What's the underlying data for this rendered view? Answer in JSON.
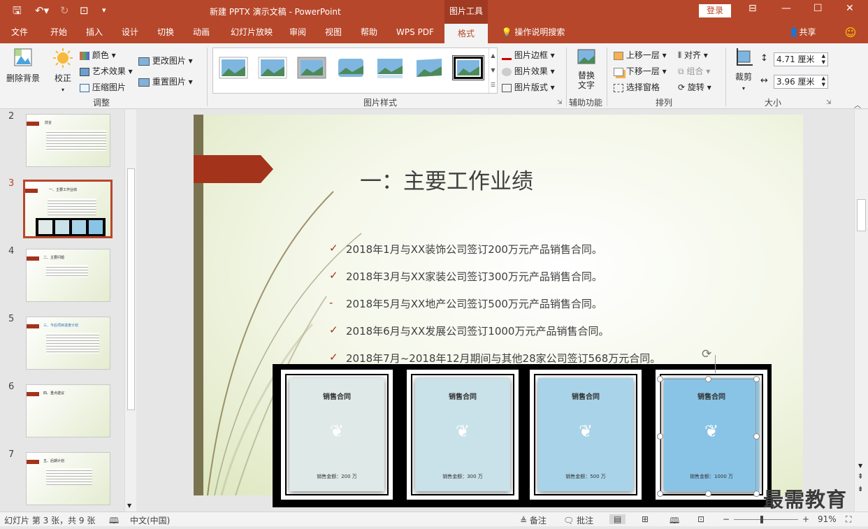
{
  "titlebar": {
    "title": "新建 PPTX 演示文稿  -  PowerPoint",
    "context_tab": "图片工具",
    "login": "登录"
  },
  "tabs": [
    "文件",
    "开始",
    "插入",
    "设计",
    "切换",
    "动画",
    "幻灯片放映",
    "审阅",
    "视图",
    "帮助",
    "WPS PDF",
    "格式"
  ],
  "active_tab": "格式",
  "tell_me": "操作说明搜索",
  "share": "共享",
  "ribbon": {
    "remove_bg": "删除背景",
    "correct": "校正",
    "color": "颜色",
    "art_effects": "艺术效果",
    "compress": "压缩图片",
    "change_pic": "更改图片",
    "reset_pic": "重置图片",
    "group_adjust": "调整",
    "group_styles": "图片样式",
    "border": "图片边框",
    "effects": "图片效果",
    "layout": "图片版式",
    "alt_text": "替换\n文字",
    "group_access": "辅助功能",
    "bring_forward": "上移一层",
    "send_backward": "下移一层",
    "selection_pane": "选择窗格",
    "align": "对齐",
    "group": "组合",
    "rotate": "旋转",
    "group_arrange": "排列",
    "crop": "裁剪",
    "height": "4.71 厘米",
    "width": "3.96 厘米",
    "group_size": "大小"
  },
  "thumbnails": [
    {
      "num": "2",
      "title": "前言"
    },
    {
      "num": "3",
      "title": "一、主要工作业绩"
    },
    {
      "num": "4",
      "title": "二、主要问题"
    },
    {
      "num": "5",
      "title": "三、今后项目进度计划"
    },
    {
      "num": "6",
      "title": "四、重点建议"
    },
    {
      "num": "7",
      "title": "五、后期计划"
    }
  ],
  "slide": {
    "title": "一：主要工作业绩",
    "bullets": [
      {
        "mark": "✓",
        "text": "2018年1月与XX装饰公司签订200万元产品销售合同。"
      },
      {
        "mark": "✓",
        "text": "2018年3月与XX家装公司签订300万元产品销售合同。"
      },
      {
        "mark": "-",
        "text": "2018年5月与XX地产公司签订500万元产品销售合同。"
      },
      {
        "mark": "✓",
        "text": "2018年6月与XX发展公司签订1000万元产品销售合同。"
      },
      {
        "mark": "✓",
        "text": "2018年7月~2018年12月期间与其他28家公司签订568万元合同。"
      }
    ],
    "pictures": [
      {
        "title": "销售合同",
        "amount": "销售金额：200 万",
        "color": "#dfe9e7"
      },
      {
        "title": "销售合同",
        "amount": "销售金额：300 万",
        "color": "#c9e1e8"
      },
      {
        "title": "销售合同",
        "amount": "销售金额：500 万",
        "color": "#a9d3e8"
      },
      {
        "title": "销售合同",
        "amount": "销售金额：1000 万",
        "color": "#89c4e6"
      }
    ]
  },
  "status": {
    "slide_info": "幻灯片 第 3 张，共 9 张",
    "language": "中文(中国)",
    "notes": "备注",
    "comments": "批注",
    "zoom": "91%"
  },
  "watermark": "最需教育",
  "colors": {
    "accent": "#b7472a",
    "slide_title": "#3f3f3f"
  }
}
